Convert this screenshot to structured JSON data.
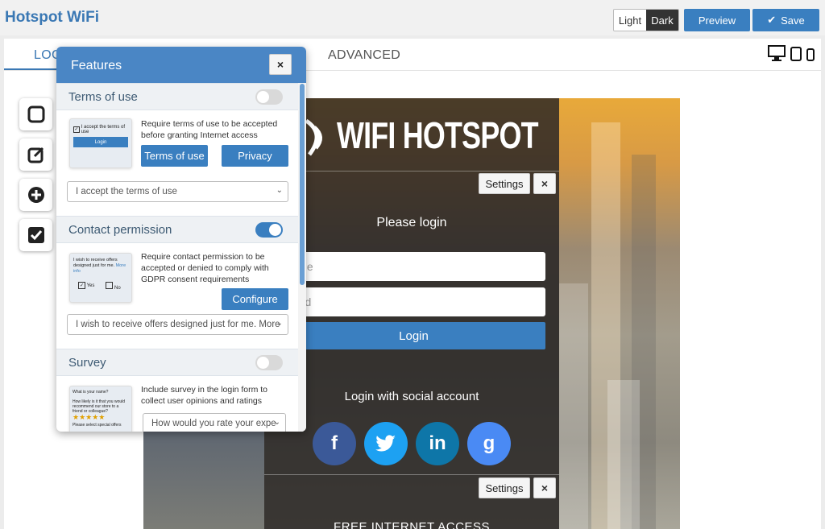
{
  "app": {
    "title": "Hotspot WiFi"
  },
  "header": {
    "theme_light": "Light",
    "theme_dark": "Dark",
    "preview_label": "Preview",
    "save_label": "Save"
  },
  "tabs": {
    "login": "LOG",
    "advanced": "ADVANCED"
  },
  "devices": [
    "desktop-icon",
    "tablet-icon",
    "phone-icon"
  ],
  "tools": [
    "square-icon",
    "edit-icon",
    "plus-circle-icon",
    "checkbox-icon"
  ],
  "features": {
    "title": "Features",
    "close": "×",
    "terms": {
      "title": "Terms of use",
      "enabled": false,
      "desc": "Require terms of use to be accepted before granting Internet access",
      "btn_terms": "Terms of use",
      "btn_privacy": "Privacy",
      "select_value": "I accept the terms of use",
      "thumb_text": "I accept the terms of use",
      "thumb_btn": "Login"
    },
    "contact": {
      "title": "Contact permission",
      "enabled": true,
      "desc": "Require contact permission to be accepted or denied to comply with GDPR consent requirements",
      "btn_configure": "Configure",
      "select_value": "I wish to receive offers designed just for me. More",
      "thumb_text": "I wish to receive offers designed just for me.",
      "thumb_link": "More info",
      "thumb_yes": "Yes",
      "thumb_no": "No"
    },
    "survey": {
      "title": "Survey",
      "enabled": false,
      "desc": "Include survey in the login form to collect user opinions and ratings",
      "select_value": "How would you rate your expe",
      "thumb_q1": "What is your name?",
      "thumb_q2": "How likely is it that you would recommend our store to a friend or colleague?",
      "thumb_q3": "Please select special offers"
    }
  },
  "preview": {
    "logo": "WIFI HOTSPOT",
    "settings": "Settings",
    "close": "×",
    "please_login": "Please login",
    "username_placeholder": "Username",
    "password_placeholder": "Password",
    "username_visible": "rname",
    "password_visible": "sword",
    "login_btn": "Login",
    "social_title": "Login with social account",
    "social": [
      {
        "name": "facebook",
        "glyph": "f",
        "color": "#3b5998"
      },
      {
        "name": "twitter",
        "glyph": "t",
        "color": "#1da1f2"
      },
      {
        "name": "linkedin",
        "glyph": "in",
        "color": "#0e76a8"
      },
      {
        "name": "google",
        "glyph": "g",
        "color": "#4a8af4"
      }
    ],
    "settings2": "Settings",
    "free_access": "FREE INTERNET ACCESS"
  }
}
